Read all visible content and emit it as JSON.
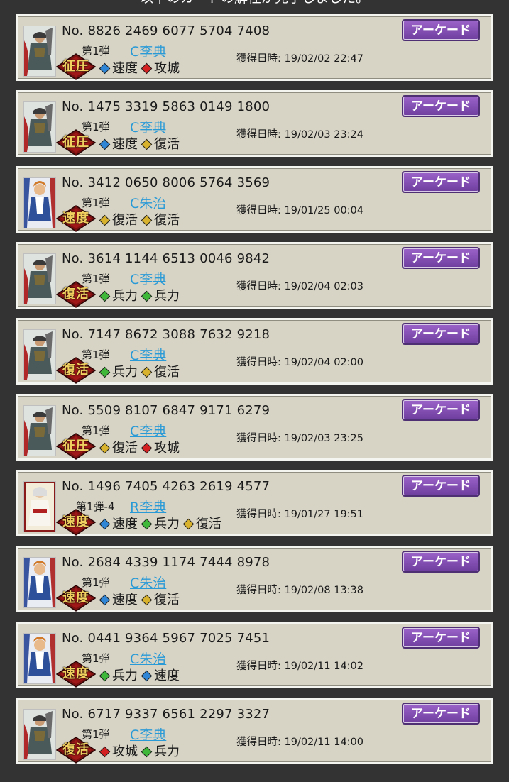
{
  "header": {
    "text": "以下のカードの解任が完了しました。"
  },
  "colors": {
    "speed": "#2f86d6",
    "siege": "#d42020",
    "revive": "#d8b22c",
    "troops": "#3fb83a",
    "card_name": "#2a9ad6",
    "button": "#7d4bb0",
    "panel": "#d7d4c6"
  },
  "cards": [
    {
      "number": "8826 2469 6077 5704 7408",
      "series": "第1弾",
      "name": "C李典",
      "seal": "征圧",
      "skills": [
        {
          "label": "速度",
          "gem": "speed"
        },
        {
          "label": "攻城",
          "gem": "siege"
        }
      ],
      "date_label": "獲得日時:",
      "date": "19/02/02 22:47",
      "button": "アーケード",
      "portrait": "li-dian"
    },
    {
      "number": "1475 3319 5863 0149 1800",
      "series": "第1弾",
      "name": "C李典",
      "seal": "征圧",
      "skills": [
        {
          "label": "速度",
          "gem": "speed"
        },
        {
          "label": "復活",
          "gem": "revive"
        }
      ],
      "date_label": "獲得日時:",
      "date": "19/02/03 23:24",
      "button": "アーケード",
      "portrait": "li-dian"
    },
    {
      "number": "3412 0650 8006 5764 3569",
      "series": "第1弾",
      "name": "C朱治",
      "seal": "速度",
      "skills": [
        {
          "label": "復活",
          "gem": "revive"
        },
        {
          "label": "復活",
          "gem": "revive"
        }
      ],
      "date_label": "獲得日時:",
      "date": "19/01/25 00:04",
      "button": "アーケード",
      "portrait": "zhu-zhi"
    },
    {
      "number": "3614 1144 6513 0046 9842",
      "series": "第1弾",
      "name": "C李典",
      "seal": "復活",
      "skills": [
        {
          "label": "兵力",
          "gem": "troops"
        },
        {
          "label": "兵力",
          "gem": "troops"
        }
      ],
      "date_label": "獲得日時:",
      "date": "19/02/04 02:03",
      "button": "アーケード",
      "portrait": "li-dian"
    },
    {
      "number": "7147 8672 3088 7632 9218",
      "series": "第1弾",
      "name": "C李典",
      "seal": "復活",
      "skills": [
        {
          "label": "兵力",
          "gem": "troops"
        },
        {
          "label": "復活",
          "gem": "revive"
        }
      ],
      "date_label": "獲得日時:",
      "date": "19/02/04 02:00",
      "button": "アーケード",
      "portrait": "li-dian"
    },
    {
      "number": "5509 8107 6847 9171 6279",
      "series": "第1弾",
      "name": "C李典",
      "seal": "征圧",
      "skills": [
        {
          "label": "復活",
          "gem": "revive"
        },
        {
          "label": "攻城",
          "gem": "siege"
        }
      ],
      "date_label": "獲得日時:",
      "date": "19/02/03 23:25",
      "button": "アーケード",
      "portrait": "li-dian"
    },
    {
      "number": "1496 7405 4263 2619 4577",
      "series": "第1弾-4",
      "name": "R李典",
      "seal": "速度",
      "skills": [
        {
          "label": "速度",
          "gem": "speed"
        },
        {
          "label": "兵力",
          "gem": "troops"
        },
        {
          "label": "復活",
          "gem": "revive"
        }
      ],
      "date_label": "獲得日時:",
      "date": "19/01/27 19:51",
      "button": "アーケード",
      "portrait": "li-dian-r"
    },
    {
      "number": "2684 4339 1174 7444 8978",
      "series": "第1弾",
      "name": "C朱治",
      "seal": "速度",
      "skills": [
        {
          "label": "速度",
          "gem": "speed"
        },
        {
          "label": "復活",
          "gem": "revive"
        }
      ],
      "date_label": "獲得日時:",
      "date": "19/02/08 13:38",
      "button": "アーケード",
      "portrait": "zhu-zhi"
    },
    {
      "number": "0441 9364 5967 7025 7451",
      "series": "第1弾",
      "name": "C朱治",
      "seal": "速度",
      "skills": [
        {
          "label": "兵力",
          "gem": "troops"
        },
        {
          "label": "速度",
          "gem": "speed"
        }
      ],
      "date_label": "獲得日時:",
      "date": "19/02/11 14:02",
      "button": "アーケード",
      "portrait": "zhu-zhi"
    },
    {
      "number": "6717 9337 6561 2297 3327",
      "series": "第1弾",
      "name": "C李典",
      "seal": "復活",
      "skills": [
        {
          "label": "攻城",
          "gem": "siege"
        },
        {
          "label": "兵力",
          "gem": "troops"
        }
      ],
      "date_label": "獲得日時:",
      "date": "19/02/11 14:00",
      "button": "アーケード",
      "portrait": "li-dian"
    }
  ]
}
